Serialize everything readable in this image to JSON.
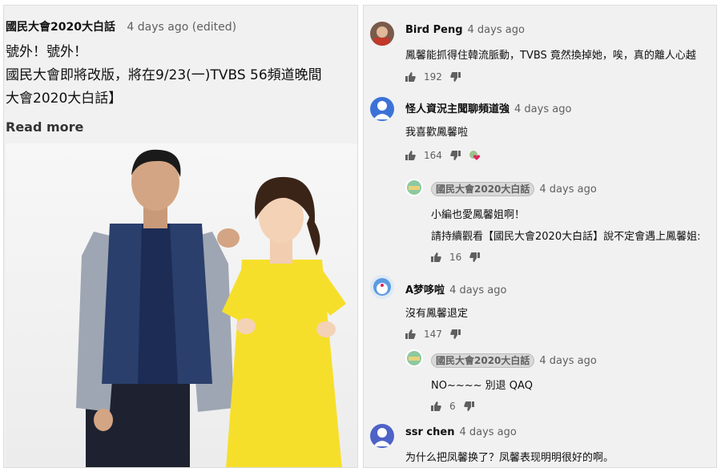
{
  "post": {
    "author": "國民大會2020大白話",
    "meta": "4 days ago (edited)",
    "lines": [
      "號外！號外！",
      "國民大會即將改版，將在9/23(一)TVBS 56頻道晚間",
      "大會2020大白話】"
    ],
    "read_more": "Read more"
  },
  "comments": [
    {
      "author": "Bird Peng",
      "time": "4 days ago",
      "text": "鳳馨能抓得住韓流脈動，TVBS 竟然換掉她，唉，真的離人心越",
      "likes": "192"
    },
    {
      "author": "怪人資況主聞聊頻道強",
      "time": "4 days ago",
      "text": "我喜歡鳳馨啦",
      "likes": "164"
    },
    {
      "author": "國民大會2020大白話",
      "time": "4 days ago",
      "text1": "小編也愛鳳馨姐啊！",
      "text2": "請持續觀看【國民大會2020大白話】說不定會遇上鳳馨姐:",
      "likes": "16"
    },
    {
      "author": "A梦哆啦",
      "time": "4 days ago",
      "text": "沒有鳳馨退定",
      "likes": "147"
    },
    {
      "author": "國民大會2020大白話",
      "time": "4 days ago",
      "text": "NO~~~~ 別退 QAQ",
      "likes": "6"
    },
    {
      "author": "ssr chen",
      "time": "4 days ago",
      "text": "为什么把凤馨换了？凤馨表现明明很好的啊。"
    }
  ],
  "colors": {
    "panel_bg": "#f1f1f1",
    "meta_gray": "#606060",
    "avatar_blue": "#4d63c7",
    "heart_red": "#e0245e",
    "dress_yellow": "#f6df2a",
    "blazer_navy": "#2a3f6b"
  }
}
